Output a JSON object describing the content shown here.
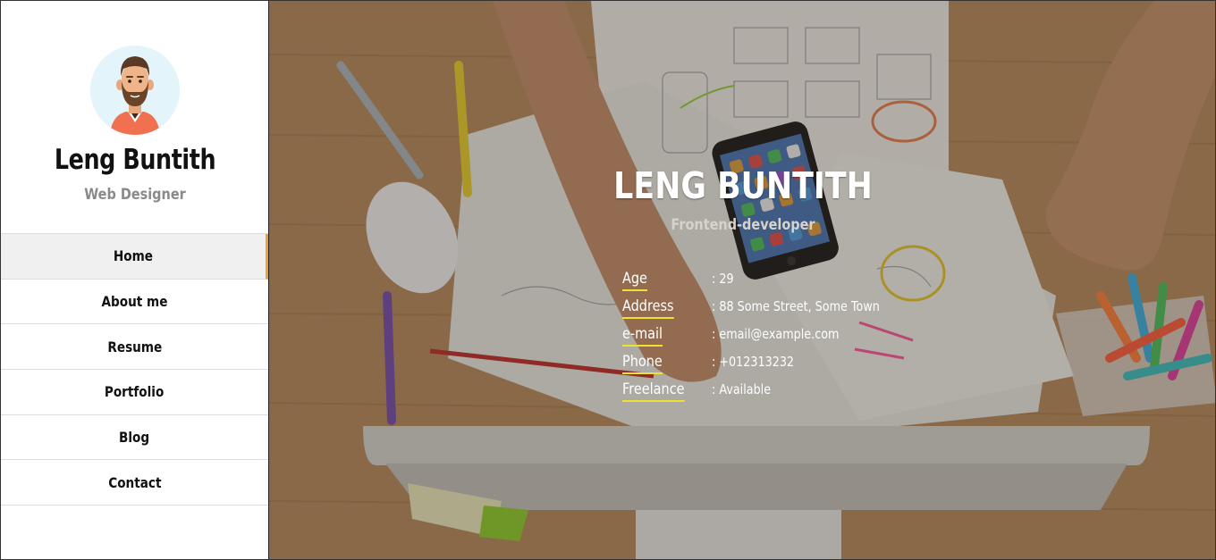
{
  "profile": {
    "name": "Leng Buntith",
    "role": "Web Designer",
    "avatar_icon": "bearded-man-avatar-icon"
  },
  "nav": {
    "items": [
      {
        "label": "Home",
        "active": true
      },
      {
        "label": "About me",
        "active": false
      },
      {
        "label": "Resume",
        "active": false
      },
      {
        "label": "Portfolio",
        "active": false
      },
      {
        "label": "Blog",
        "active": false
      },
      {
        "label": "Contact",
        "active": false
      }
    ]
  },
  "hero": {
    "title": "LENG BUNTITH",
    "subtitle": "Frontend-developer",
    "info": [
      {
        "label": "Age",
        "value": ": 29"
      },
      {
        "label": "Address",
        "value": ": 88 Some Street, Some Town"
      },
      {
        "label": "e-mail",
        "value": ": email@example.com"
      },
      {
        "label": "Phone",
        "value": ": +012313232"
      },
      {
        "label": "Freelance",
        "value": ": Available"
      }
    ]
  },
  "colors": {
    "accent": "#f0a030",
    "underline": "#f0e030",
    "sidebar_bg": "#ffffff",
    "hero_wood": "#b48a62"
  }
}
